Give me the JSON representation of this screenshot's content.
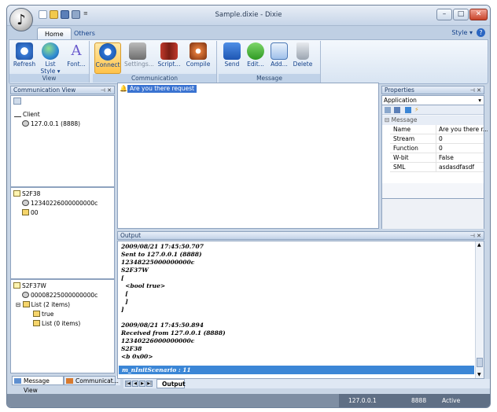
{
  "window": {
    "title": "Sample.dixie - Dixie"
  },
  "ribbon": {
    "tabs": [
      {
        "label": "Home"
      },
      {
        "label": "Others"
      }
    ],
    "style_label": "Style",
    "groups": [
      {
        "label": "View",
        "buttons": [
          {
            "label": "Refresh"
          },
          {
            "label": "List Style"
          },
          {
            "label": "Font..."
          }
        ]
      },
      {
        "label": "Communication",
        "buttons": [
          {
            "label": "Connect"
          },
          {
            "label": "Settings..."
          },
          {
            "label": "Script..."
          },
          {
            "label": "Compile"
          }
        ]
      },
      {
        "label": "Message",
        "buttons": [
          {
            "label": "Send"
          },
          {
            "label": "Edit..."
          },
          {
            "label": "Add..."
          },
          {
            "label": "Delete"
          }
        ]
      }
    ]
  },
  "communication_view": {
    "title": "Communication View",
    "client_label": "Client",
    "endpoint": "127.0.0.1 (8888)"
  },
  "msg1": {
    "name": "S2F38",
    "systembytes": "12340226000000000c",
    "item": "00"
  },
  "msg2": {
    "name": "S2F37W",
    "systembytes": "00008225000000000c",
    "list": "List (2 items)",
    "item_true": "true",
    "list_empty": "List (0 items)"
  },
  "bottom_tabs": [
    {
      "label": "Message View"
    },
    {
      "label": "Communicat..."
    }
  ],
  "editor": {
    "selected_item": "Are you there request"
  },
  "properties": {
    "title": "Properties",
    "selector": "Application",
    "section": "Message",
    "rows": [
      {
        "key": "Name",
        "value": "Are you there r..."
      },
      {
        "key": "Stream",
        "value": "0"
      },
      {
        "key": "Function",
        "value": "0"
      },
      {
        "key": "W-bit",
        "value": "False"
      },
      {
        "key": "SML",
        "value": "asdasdfasdf"
      }
    ]
  },
  "output": {
    "title": "Output",
    "lines": [
      "2009/08/21 17:45:50.707",
      "Sent to 127.0.0.1 (8888)",
      "12348225000000000c",
      "S2F37W",
      "[",
      "  <bool true>",
      "  [",
      "  ]",
      "]",
      "",
      "2009/08/21 17:45:50.894",
      "Received from 127.0.0.1 (8888)",
      "12340226000000000c",
      "S2F38",
      "<b 0x00>"
    ],
    "highlight": "m_nInitScenario : 11",
    "tab": "Output"
  },
  "status": {
    "ip": "127.0.0.1",
    "port": "8888",
    "state": "Active"
  }
}
